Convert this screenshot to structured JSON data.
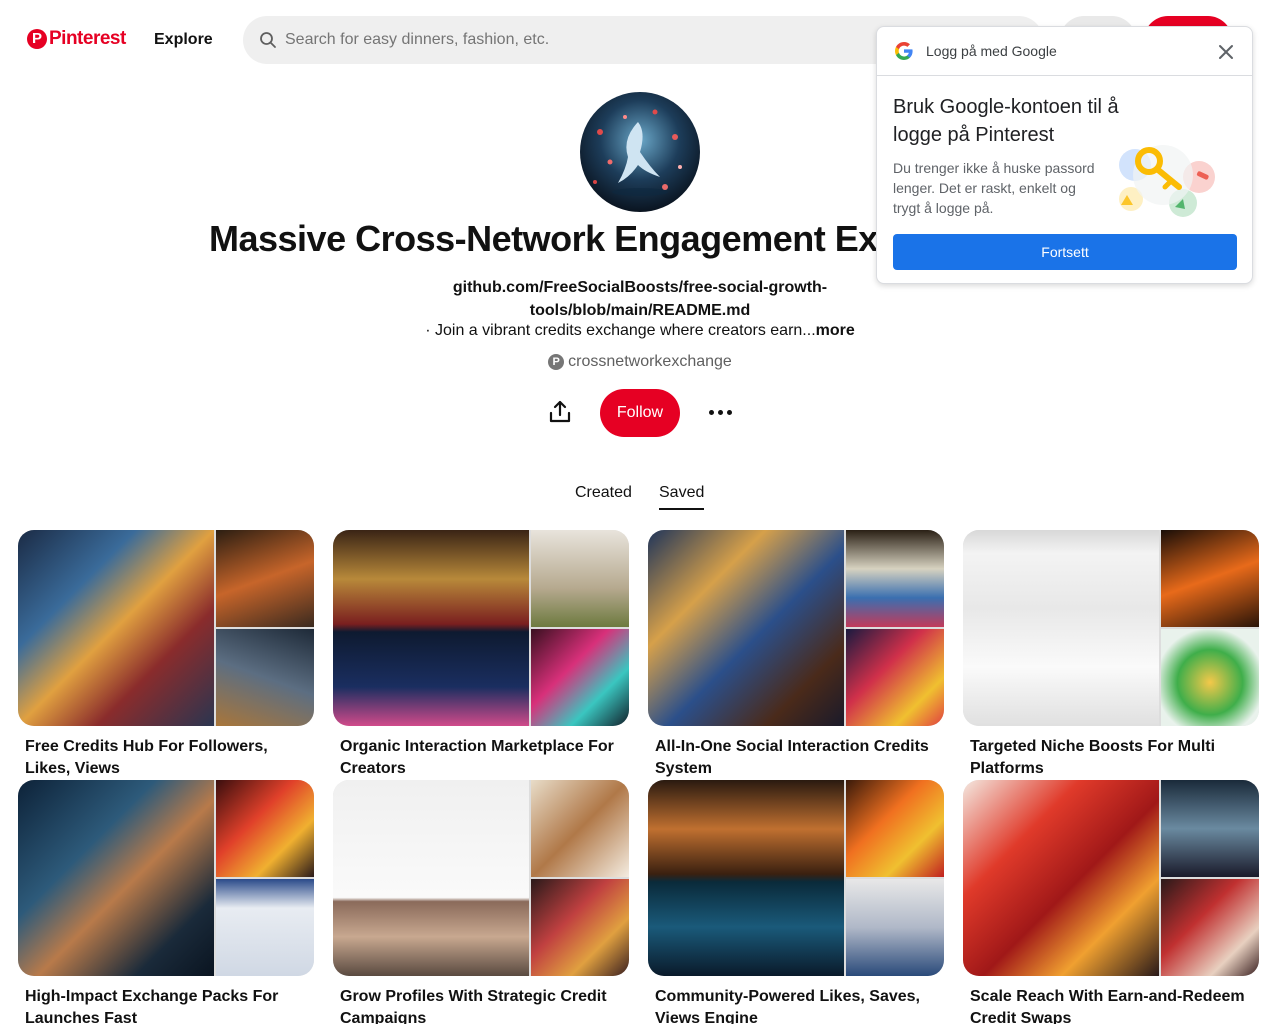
{
  "header": {
    "logo_text": "Pinterest",
    "explore_label": "Explore",
    "search_placeholder": "Search for easy dinners, fashion, etc."
  },
  "profile": {
    "title": "Massive Cross-Network Engagement Exchange",
    "link": "github.com/FreeSocialBoosts/free-social-growth-tools/blob/main/README.md",
    "description": "· Join a vibrant credits exchange where creators earn...",
    "description_more": "more",
    "username": "crossnetworkexchange",
    "follow_label": "Follow"
  },
  "tabs": [
    {
      "label": "Created"
    },
    {
      "label": "Saved",
      "active": true
    }
  ],
  "boards": [
    {
      "title": "Free Credits Hub For Followers, Likes, Views"
    },
    {
      "title": "Organic Interaction Marketplace For Creators"
    },
    {
      "title": "All-In-One Social Interaction Credits System"
    },
    {
      "title": "Targeted Niche Boosts For Multi Platforms"
    },
    {
      "title": "High-Impact Exchange Packs For Launches Fast"
    },
    {
      "title": "Grow Profiles With Strategic Credit Campaigns"
    },
    {
      "title": "Community-Powered Likes, Saves, Views Engine"
    },
    {
      "title": "Scale Reach With Earn-and-Redeem Credit Swaps"
    }
  ],
  "google_popup": {
    "header_label": "Logg på med Google",
    "title": "Bruk Google-kontoen til å logge på Pinterest",
    "body": "Du trenger ikke å huske passord lenger. Det er raskt, enkelt og trygt å logge på.",
    "button_label": "Fortsett"
  },
  "colors": {
    "brand": "#e60023",
    "google_blue": "#1a73e8"
  }
}
